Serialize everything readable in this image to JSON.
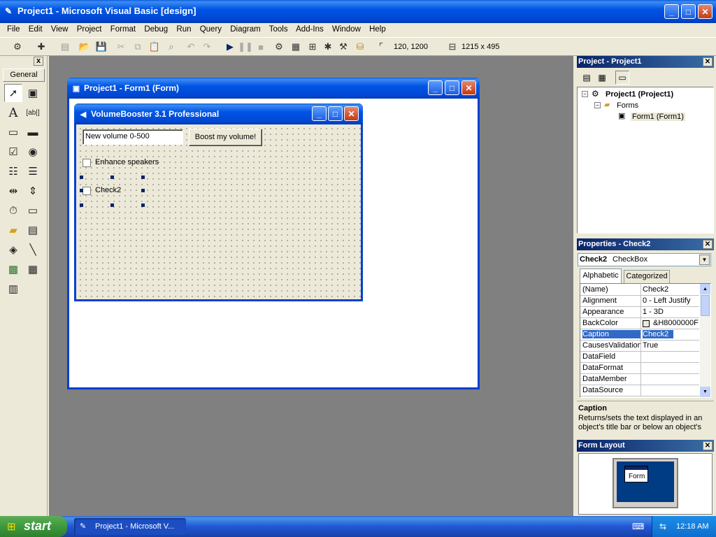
{
  "app": {
    "title": "Project1 - Microsoft Visual Basic [design]"
  },
  "menu": [
    "File",
    "Edit",
    "View",
    "Project",
    "Format",
    "Debug",
    "Run",
    "Query",
    "Diagram",
    "Tools",
    "Add-Ins",
    "Window",
    "Help"
  ],
  "toolbar": {
    "position_readout": "120, 1200",
    "size_readout": "1215 x 495"
  },
  "toolbox": {
    "tab_label": "General",
    "close_label": "x"
  },
  "form_window": {
    "title": "Project1 - Form1 (Form)"
  },
  "designed_form": {
    "title": "VolumeBooster 3.1 Professional",
    "textbox_value": "New volume 0-500",
    "button_label": "Boost my volume!",
    "checkbox1_label": "Enhance speakers",
    "checkbox2_label": "Check2"
  },
  "project_explorer": {
    "title": "Project - Project1",
    "root": "Project1 (Project1)",
    "folder": "Forms",
    "item": "Form1 (Form1)"
  },
  "properties": {
    "title": "Properties - Check2",
    "object_name": "Check2",
    "object_type": "CheckBox",
    "tab_alphabetic": "Alphabetic",
    "tab_categorized": "Categorized",
    "rows": [
      {
        "name": "(Name)",
        "value": "Check2"
      },
      {
        "name": "Alignment",
        "value": "0 - Left Justify"
      },
      {
        "name": "Appearance",
        "value": "1 - 3D"
      },
      {
        "name": "BackColor",
        "value": "&H8000000F"
      },
      {
        "name": "Caption",
        "value": "Check2"
      },
      {
        "name": "CausesValidation",
        "value": "True"
      },
      {
        "name": "DataField",
        "value": ""
      },
      {
        "name": "DataFormat",
        "value": ""
      },
      {
        "name": "DataMember",
        "value": ""
      },
      {
        "name": "DataSource",
        "value": ""
      }
    ],
    "selected_row": 4,
    "desc_title": "Caption",
    "desc_text": "Returns/sets the text displayed in an object's title bar or below an object's"
  },
  "form_layout": {
    "title": "Form Layout",
    "preview_label": "Form"
  },
  "taskbar": {
    "start_label": "start",
    "task_label": "Project1 - Microsoft V...",
    "clock": "12:18 AM"
  },
  "colors": {
    "xp_blue": "#0055e5",
    "panel_title": "#0a246a",
    "start_green": "#3c9a3c",
    "mdi_bg": "#808080"
  }
}
